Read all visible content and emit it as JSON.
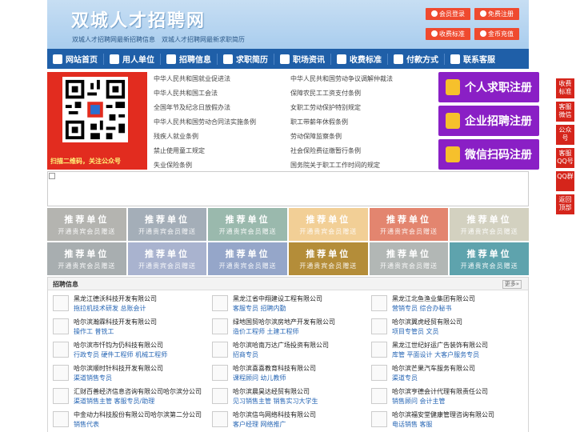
{
  "header": {
    "title": "双城人才招聘网",
    "subtitle": "双城人才招聘网最新招聘信息　双城人才招聘网最新求职简历",
    "buttons": {
      "login": "会员登录",
      "register": "免费注册",
      "fees": "收费标准",
      "recharge": "金币充值"
    }
  },
  "nav": {
    "items": [
      "网站首页",
      "用人单位",
      "招聘信息",
      "求职简历",
      "职场资讯",
      "收费标准",
      "付款方式",
      "联系客服"
    ]
  },
  "qr": {
    "caption": "扫描二维码，关注公众号"
  },
  "laws": {
    "left": [
      "中华人民共和国就业促进法",
      "中华人民共和国工会法",
      "全国年节及纪念日放假办法",
      "中华人民共和国劳动合同法实施条例",
      "残疾人就业条例",
      "禁止使用童工规定",
      "失业保险条例"
    ],
    "right": [
      "中华人民共和国劳动争议调解仲裁法",
      "保障农民工工资支付条例",
      "女职工劳动保护特别规定",
      "职工带薪年休假条例",
      "劳动保障监察条例",
      "社会保险费征缴暂行条例",
      "国务院关于职工工作时间的规定"
    ]
  },
  "register": {
    "seeker": "个人求职注册",
    "company": "企业招聘注册",
    "wechat": "微信扫码注册"
  },
  "tiles": {
    "title": "推荐单位",
    "sub": "开通贵宾会员赠送",
    "colors": [
      "#b4b4b0",
      "#a4aeb8",
      "#9ab9ad",
      "#f2cf96",
      "#e3856f",
      "#d3d1c0",
      "#a8aeb0",
      "#a9b3cf",
      "#95a6c9",
      "#b48d39",
      "#b2b7b5",
      "#5ea3ad"
    ]
  },
  "jobs": {
    "title": "招聘信息",
    "more": "更多»",
    "items": [
      {
        "company": "黑龙江德沃科技开发有限公司",
        "positions": "拖拉机技术研发 总账会计"
      },
      {
        "company": "黑龙江省中翔建设工程有限公司",
        "positions": "客服专员 招聘内勤"
      },
      {
        "company": "黑龙江北鱼渔业集团有限公司",
        "positions": "营销专员 综合办秘书"
      },
      {
        "company": "哈尔滨瀚霖科技开发有限公司",
        "positions": "操作工 普铣工"
      },
      {
        "company": "绿地国贸哈尔滨房地产开发有限公司",
        "positions": "造价工程师 土建工程师"
      },
      {
        "company": "哈尔滨翼虎经贸有限公司",
        "positions": "项目专管员 文员"
      },
      {
        "company": "哈尔滨市忏钧为仍科技有限公司",
        "positions": "行政专员 硬件工程师 机械工程师"
      },
      {
        "company": "哈尔滨哈南万达广场投资有限公司",
        "positions": "招商专员"
      },
      {
        "company": "黑龙江世纪好运广告装饰有限公司",
        "positions": "库管 平面设计 大客户服务专员"
      },
      {
        "company": "哈尔滨顺时针科技开发有限公司",
        "positions": "渠道销售专员"
      },
      {
        "company": "哈尔滨喜喜教育科技有限公司",
        "positions": "课程顾问 幼儿教师"
      },
      {
        "company": "哈尔滨芒果汽车服务有限公司",
        "positions": "渠道专员"
      },
      {
        "company": "汇财百善经济信息咨询有限公司哈尔滨分公司",
        "positions": "渠道销售主管 客服专员/助理"
      },
      {
        "company": "哈尔滨晨昊达经贸有限公司",
        "positions": "见习销售主管 销售实习大学生"
      },
      {
        "company": "哈尔滨亨德会计代理有限责任公司",
        "positions": "销售顾问 会计主管"
      },
      {
        "company": "中金动力科技股份有限公司哈尔滨第二分公司",
        "positions": "销售代表"
      },
      {
        "company": "哈尔滨信鸟网络科技有限公司",
        "positions": "客户经理 网络推广"
      },
      {
        "company": "哈尔滨福安堂健康管理咨询有限公司",
        "positions": "电话销售 客服"
      }
    ]
  },
  "floaters": [
    "收费标准",
    "客服微信",
    "公众号",
    "客服QQ号",
    "QQ群",
    "返回顶部"
  ]
}
